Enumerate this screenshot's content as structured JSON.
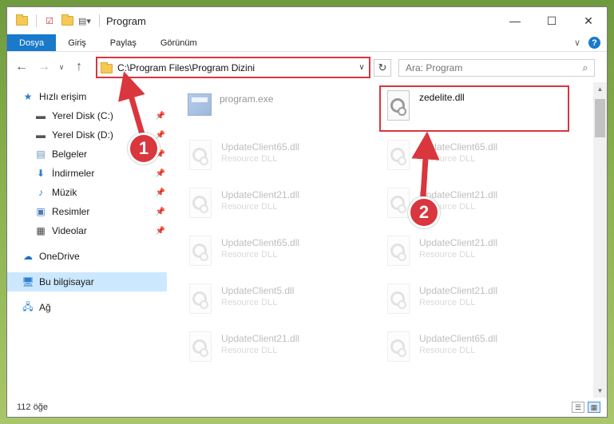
{
  "window": {
    "title": "Program",
    "controls": {
      "minimize": "—",
      "maximize": "☐",
      "close": "✕"
    }
  },
  "ribbon": {
    "tabs": [
      {
        "label": "Dosya",
        "active": true
      },
      {
        "label": "Giriş"
      },
      {
        "label": "Paylaş"
      },
      {
        "label": "Görünüm"
      }
    ],
    "help": "?"
  },
  "nav": {
    "address": "C:\\Program Files\\Program Dizini",
    "search_placeholder": "Ara: Program"
  },
  "sidebar": {
    "items": [
      {
        "label": "Hızlı erişim",
        "icon": "star-icon"
      },
      {
        "label": "Yerel Disk (C:)",
        "icon": "drive-icon",
        "pinned": true
      },
      {
        "label": "Yerel Disk (D:)",
        "icon": "drive-icon",
        "pinned": true
      },
      {
        "label": "Belgeler",
        "icon": "documents-icon",
        "pinned": true
      },
      {
        "label": "İndirmeler",
        "icon": "download-icon",
        "pinned": true
      },
      {
        "label": "Müzik",
        "icon": "music-icon",
        "pinned": true
      },
      {
        "label": "Resimler",
        "icon": "pictures-icon",
        "pinned": true
      },
      {
        "label": "Videolar",
        "icon": "video-icon",
        "pinned": true
      },
      {
        "label": "OneDrive",
        "icon": "cloud-icon"
      },
      {
        "label": "Bu bilgisayar",
        "icon": "computer-icon",
        "selected": true
      },
      {
        "label": "Ağ",
        "icon": "network-icon"
      }
    ]
  },
  "files": [
    {
      "name": "program.exe",
      "desc": ""
    },
    {
      "name": "zedelite.dll",
      "desc": ""
    },
    {
      "name": "UpdateClient65.dll",
      "desc": "Resource DLL"
    },
    {
      "name": "UpdateClient65.dll",
      "desc": "Resource DLL"
    },
    {
      "name": "UpdateClient21.dll",
      "desc": "Resource DLL"
    },
    {
      "name": "UpdateClient21.dll",
      "desc": "Resource DLL"
    },
    {
      "name": "UpdateClient65.dll",
      "desc": "Resource DLL"
    },
    {
      "name": "UpdateClient21.dll",
      "desc": "Resource DLL"
    },
    {
      "name": "UpdateClient5.dll",
      "desc": "Resource DLL"
    },
    {
      "name": "UpdateClient21.dll",
      "desc": "Resource DLL"
    },
    {
      "name": "UpdateClient21.dll",
      "desc": "Resource DLL"
    },
    {
      "name": "UpdateClient65.dll",
      "desc": "Resource DLL"
    }
  ],
  "status": {
    "count": "112 öğe"
  },
  "annotations": {
    "step1": "1",
    "step2": "2",
    "color": "#d9363e"
  }
}
